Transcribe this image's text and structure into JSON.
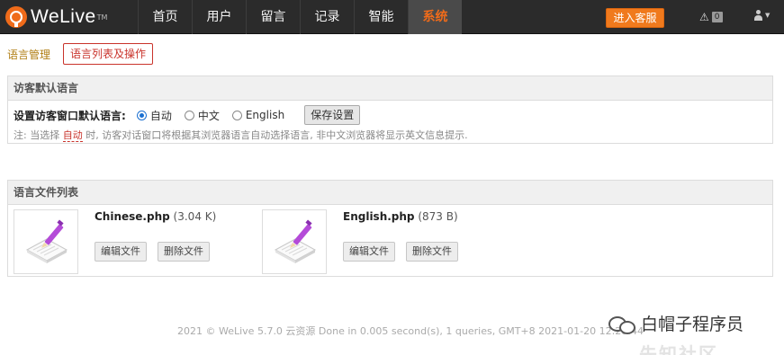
{
  "app": {
    "name": "WeLive",
    "tm": "TM"
  },
  "nav": {
    "items": [
      {
        "label": "首页"
      },
      {
        "label": "用户"
      },
      {
        "label": "留言"
      },
      {
        "label": "记录"
      },
      {
        "label": "智能"
      },
      {
        "label": "系统",
        "active": true
      }
    ],
    "enter_service": "进入客服",
    "warning_count": "0"
  },
  "breadcrumb": {
    "section": "语言管理",
    "page": "语言列表及操作"
  },
  "default_language": {
    "title": "访客默认语言",
    "label": "设置访客窗口默认语言:",
    "options": [
      "自动",
      "中文",
      "English"
    ],
    "selected": "自动",
    "save_label": "保存设置",
    "note_prefix": "注: 当选择",
    "note_highlight": "自动",
    "note_suffix": "时, 访客对话窗口将根据其浏览器语言自动选择语言, 非中文浏览器将显示英文信息提示."
  },
  "files": {
    "title": "语言文件列表",
    "items": [
      {
        "name": "Chinese.php",
        "size": "(3.04 K)",
        "edit_label": "编辑文件",
        "delete_label": "删除文件"
      },
      {
        "name": "English.php",
        "size": "(873 B)",
        "edit_label": "编辑文件",
        "delete_label": "删除文件"
      }
    ]
  },
  "footer": {
    "text": "2021 © WeLive 5.7.0 云资源 Done in 0.005 second(s), 1 queries, GMT+8 2021-01-20 12:28:44"
  },
  "watermark": {
    "text": "白帽子程序员",
    "text2": "先知社区"
  },
  "colors": {
    "accent": "#ef6b1a",
    "nav_bg": "#2b2b2b",
    "danger": "#c9332b",
    "radio": "#1a6fd1"
  }
}
